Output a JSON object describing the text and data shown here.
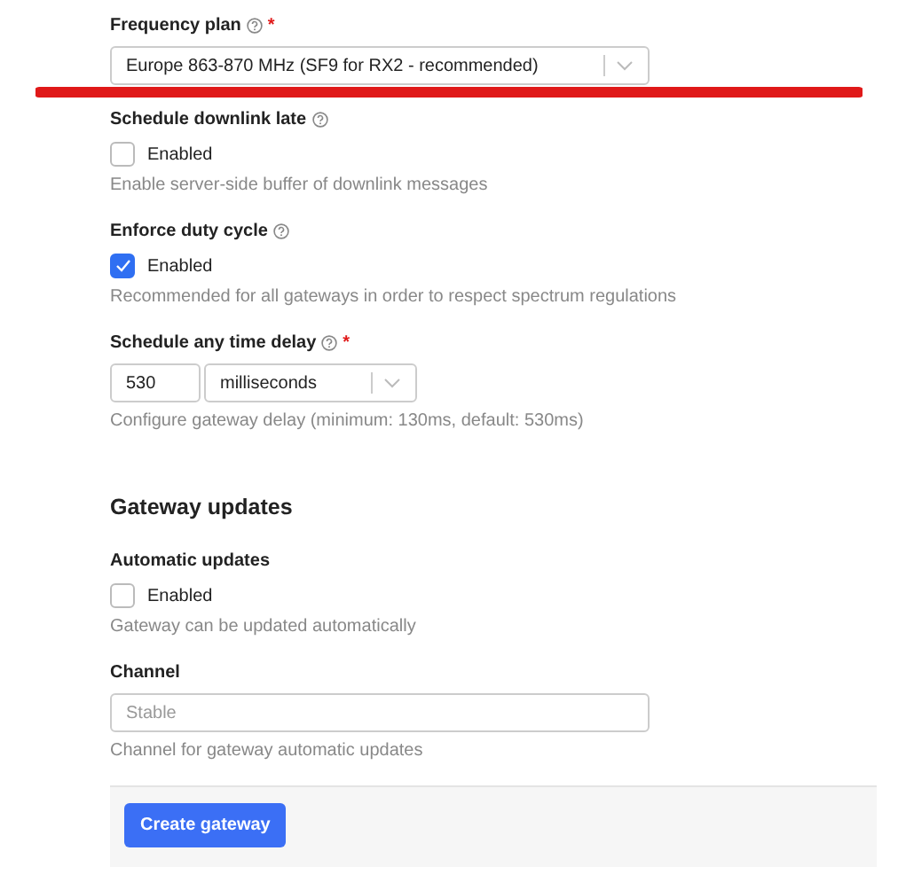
{
  "fields": [
    {
      "kind": "select",
      "label": "Frequency plan",
      "help_icon": true,
      "required_mark": "*",
      "value": "Europe 863-870 MHz (SF9 for RX2 - recommended)"
    },
    {
      "kind": "checkbox",
      "label": "Schedule downlink late",
      "help_icon": true,
      "option": "Enabled",
      "checked": false,
      "description": "Enable server-side buffer of downlink messages"
    },
    {
      "kind": "checkbox",
      "label": "Enforce duty cycle",
      "help_icon": true,
      "option": "Enabled",
      "checked": true,
      "description": "Recommended for all gateways in order to respect spectrum regulations"
    },
    {
      "kind": "duration",
      "label": "Schedule any time delay",
      "help_icon": true,
      "required_mark": "*",
      "value": "530",
      "unit": "milliseconds",
      "description": "Configure gateway delay (minimum: 130ms, default: 530ms)"
    }
  ],
  "section": {
    "title": "Gateway updates",
    "fields": [
      {
        "kind": "checkbox",
        "label": "Automatic updates",
        "option": "Enabled",
        "checked": false,
        "description": "Gateway can be updated automatically"
      },
      {
        "kind": "text",
        "label": "Channel",
        "placeholder": "Stable",
        "description": "Channel for gateway automatic updates"
      }
    ]
  },
  "submit": "Create gateway"
}
